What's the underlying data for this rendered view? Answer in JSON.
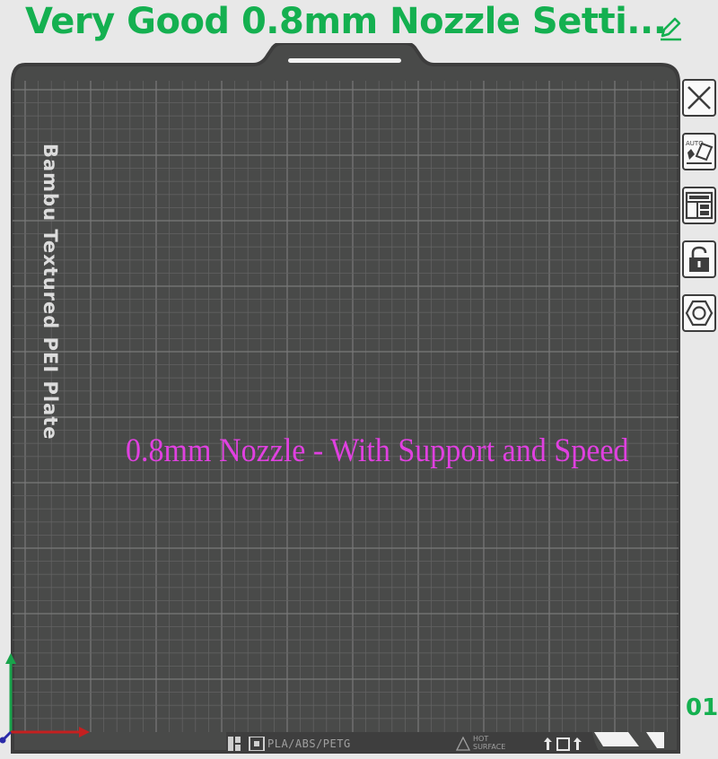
{
  "header": {
    "title": "Very Good 0.8mm Nozzle Setti...",
    "edit_icon": "pencil-icon"
  },
  "plate": {
    "plate_name": "Bambu Textured PEI Plate",
    "object_label": "0.8mm Nozzle - With Support and Speed",
    "index": "01",
    "materials": "PLA/ABS/PETG",
    "hot_surface_line1": "HOT",
    "hot_surface_line2": "SURFACE"
  },
  "toolbar": {
    "buttons": [
      {
        "name": "close",
        "icon": "close-icon"
      },
      {
        "name": "auto-orient",
        "icon": "auto-orient-icon"
      },
      {
        "name": "arrange",
        "icon": "arrange-icon"
      },
      {
        "name": "lock",
        "icon": "lock-icon"
      },
      {
        "name": "settings",
        "icon": "hex-nut-icon"
      }
    ]
  },
  "colors": {
    "title_green": "#14b050",
    "plate_bg": "#494a49",
    "label_magenta": "#e040e0"
  }
}
